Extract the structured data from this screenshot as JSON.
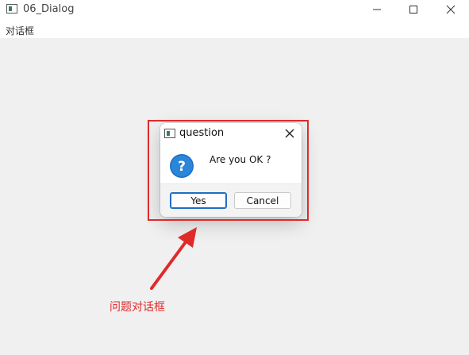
{
  "window": {
    "title": "06_Dialog",
    "menu": "对话框"
  },
  "dialog": {
    "title": "question",
    "message": "Are you OK ?",
    "yes_label": "Yes",
    "cancel_label": "Cancel",
    "icon": "question-icon"
  },
  "annotation": {
    "label": "问题对话框",
    "color": "#e02a2a"
  }
}
